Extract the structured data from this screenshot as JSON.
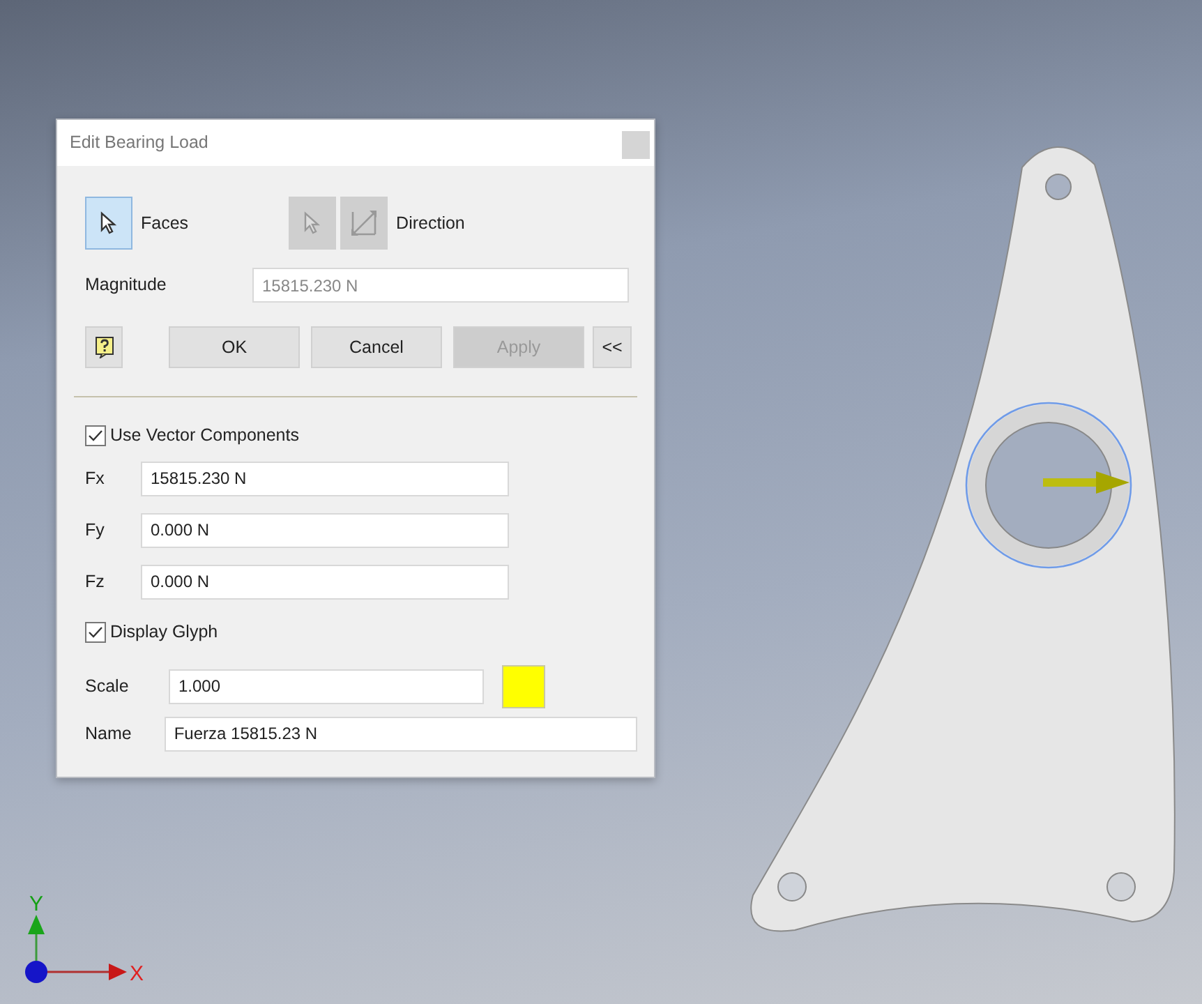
{
  "dialog": {
    "title": "Edit Bearing Load",
    "faces": {
      "label": "Faces",
      "selected": true
    },
    "direction": {
      "label": "Direction",
      "disabled": true
    },
    "magnitude": {
      "label": "Magnitude",
      "value": "15815.230 N",
      "disabled": true
    },
    "buttons": [
      {
        "kind": "help",
        "disabled": false
      },
      {
        "kind": "text",
        "label": "OK",
        "disabled": false
      },
      {
        "kind": "text",
        "label": "Cancel",
        "disabled": false
      },
      {
        "kind": "text",
        "label": "Apply",
        "disabled": true
      },
      {
        "kind": "text",
        "label": "<<",
        "disabled": false
      }
    ],
    "use_vector_components": {
      "label": "Use Vector Components",
      "checked": true
    },
    "components": [
      {
        "label": "Fx",
        "value": "15815.230 N"
      },
      {
        "label": "Fy",
        "value": "0.000 N"
      },
      {
        "label": "Fz",
        "value": "0.000 N"
      }
    ],
    "display_glyph": {
      "label": "Display Glyph",
      "checked": true
    },
    "scale": {
      "label": "Scale",
      "value": "1.000",
      "color": "#ffff00"
    },
    "name": {
      "label": "Name",
      "value": "Fuerza 15815.23 N"
    }
  },
  "axis_triad": {
    "x_label": "X",
    "y_label": "Y"
  }
}
